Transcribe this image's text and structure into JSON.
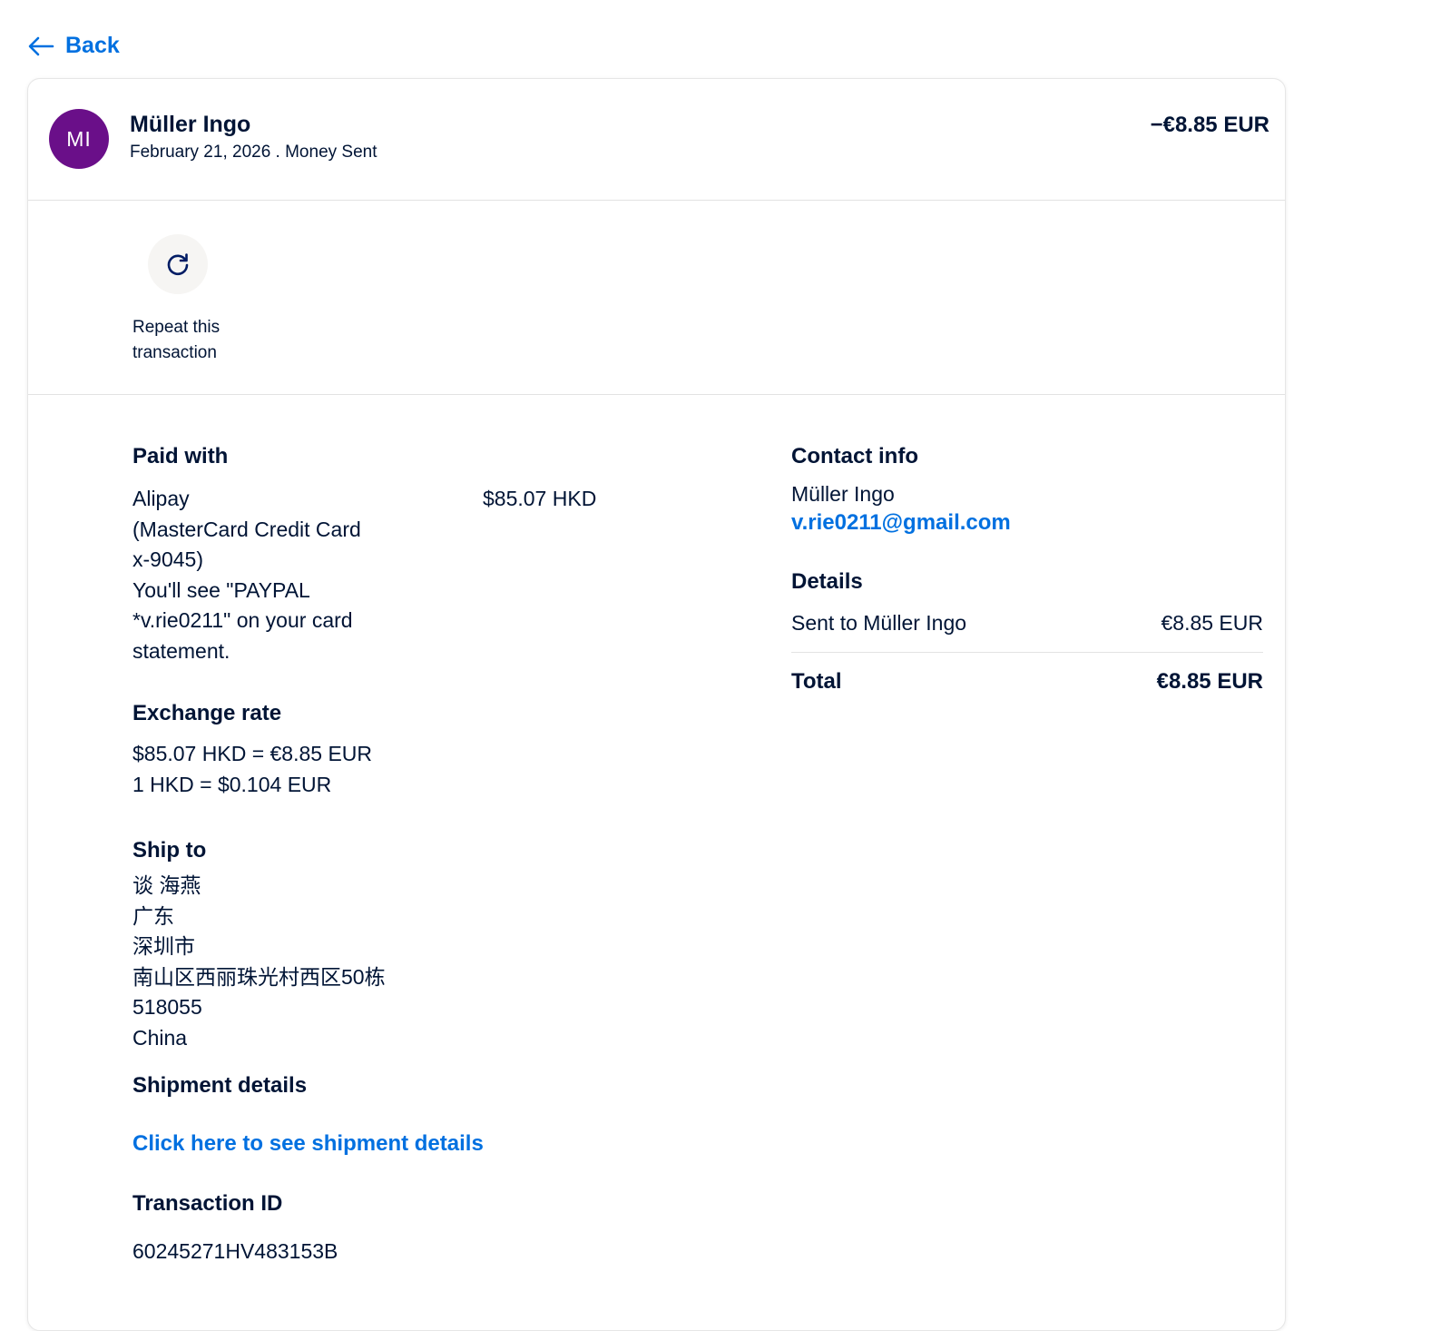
{
  "nav": {
    "back_label": "Back"
  },
  "header": {
    "avatar_initials": "MI",
    "avatar_color": "#6a0f89",
    "name": "Müller Ingo",
    "subtitle": "February 21, 2026 . Money Sent",
    "amount": "−€8.85 EUR"
  },
  "actions": {
    "repeat_label": "Repeat this transaction"
  },
  "paid_with": {
    "heading": "Paid with",
    "method_lines": [
      "Alipay",
      "(MasterCard Credit Card",
      "x-9045)",
      "You'll see \"PAYPAL",
      "*v.rie0211\" on your card",
      "statement."
    ],
    "amount": "$85.07 HKD"
  },
  "exchange_rate": {
    "heading": "Exchange rate",
    "lines": [
      "$85.07 HKD = €8.85 EUR",
      "1 HKD = $0.104 EUR"
    ]
  },
  "ship_to": {
    "heading": "Ship to",
    "lines": [
      "谈 海燕",
      "广东",
      "深圳市",
      "南山区西丽珠光村西区50栋",
      "518055",
      "China"
    ]
  },
  "shipment_details": {
    "heading": "Shipment details",
    "link_label": "Click here to see shipment details"
  },
  "transaction": {
    "heading": "Transaction ID",
    "id": "60245271HV483153B"
  },
  "contact_info": {
    "heading": "Contact info",
    "name": "Müller Ingo",
    "email": "v.rie0211@gmail.com"
  },
  "details": {
    "heading": "Details",
    "sent_label": "Sent to Müller Ingo",
    "sent_amount": "€8.85 EUR",
    "total_label": "Total",
    "total_amount": "€8.85 EUR"
  },
  "colors": {
    "accent": "#0070e0",
    "text": "#001435"
  }
}
